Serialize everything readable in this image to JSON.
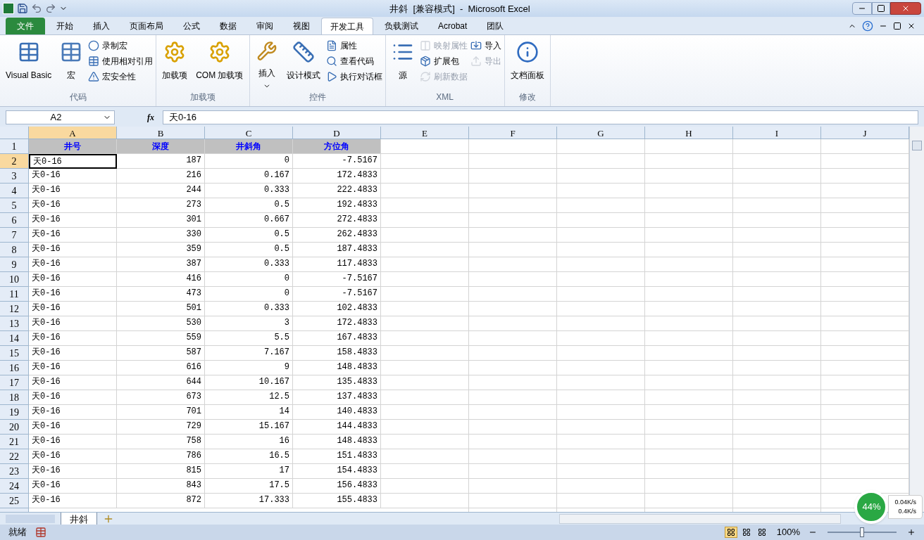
{
  "window": {
    "title": "井斜  [兼容模式]  -  Microsoft Excel"
  },
  "ribbon_tabs": [
    {
      "label": "文件",
      "kind": "file",
      "selected": false
    },
    {
      "label": "开始",
      "kind": "tab",
      "selected": false
    },
    {
      "label": "插入",
      "kind": "tab",
      "selected": false
    },
    {
      "label": "页面布局",
      "kind": "tab",
      "selected": false
    },
    {
      "label": "公式",
      "kind": "tab",
      "selected": false
    },
    {
      "label": "数据",
      "kind": "tab",
      "selected": false
    },
    {
      "label": "审阅",
      "kind": "tab",
      "selected": false
    },
    {
      "label": "视图",
      "kind": "tab",
      "selected": false
    },
    {
      "label": "开发工具",
      "kind": "tab",
      "selected": true
    },
    {
      "label": "负载测试",
      "kind": "tab",
      "selected": false
    },
    {
      "label": "Acrobat",
      "kind": "tab",
      "selected": false
    },
    {
      "label": "团队",
      "kind": "tab",
      "selected": false
    }
  ],
  "ribbon_groups": [
    {
      "label": "代码",
      "large": [
        {
          "label": "Visual Basic",
          "disabled": false
        },
        {
          "label": "宏",
          "disabled": false
        }
      ],
      "small": [
        {
          "label": "录制宏",
          "disabled": false
        },
        {
          "label": "使用相对引用",
          "disabled": false
        },
        {
          "label": "宏安全性",
          "disabled": false
        }
      ]
    },
    {
      "label": "加载项",
      "large": [
        {
          "label": "加载项",
          "disabled": false
        },
        {
          "label": "COM 加载项",
          "disabled": false
        }
      ]
    },
    {
      "label": "控件",
      "large": [
        {
          "label": "插入",
          "disabled": false,
          "dropdown": true
        },
        {
          "label": "设计模式",
          "disabled": false
        }
      ],
      "small": [
        {
          "label": "属性",
          "disabled": false
        },
        {
          "label": "查看代码",
          "disabled": false
        },
        {
          "label": "执行对话框",
          "disabled": false
        }
      ]
    },
    {
      "label": "XML",
      "large": [
        {
          "label": "源",
          "disabled": false
        }
      ],
      "small": [
        {
          "label": "映射属性",
          "disabled": true
        },
        {
          "label": "扩展包",
          "disabled": false
        },
        {
          "label": "刷新数据",
          "disabled": true
        },
        {
          "label": "导入",
          "disabled": false
        },
        {
          "label": "导出",
          "disabled": true
        }
      ]
    },
    {
      "label": "修改",
      "large": [
        {
          "label": "文档面板",
          "disabled": false
        }
      ]
    }
  ],
  "formula_bar": {
    "name_box": "A2",
    "fx": "fx",
    "value": "天0-16"
  },
  "columns": [
    {
      "label": "A",
      "selected": true
    },
    {
      "label": "B",
      "selected": false
    },
    {
      "label": "C",
      "selected": false
    },
    {
      "label": "D",
      "selected": false
    },
    {
      "label": "E",
      "selected": false
    },
    {
      "label": "F",
      "selected": false
    },
    {
      "label": "G",
      "selected": false
    },
    {
      "label": "H",
      "selected": false
    },
    {
      "label": "I",
      "selected": false
    },
    {
      "label": "J",
      "selected": false
    }
  ],
  "header_row": {
    "number": "1",
    "cells": [
      "井号",
      "深度",
      "井斜角",
      "方位角"
    ]
  },
  "rows": [
    {
      "number": "2",
      "selected": true,
      "cells": [
        "天0-16",
        "187",
        "0",
        "-7.5167"
      ]
    },
    {
      "number": "3",
      "selected": false,
      "cells": [
        "天0-16",
        "216",
        "0.167",
        "172.4833"
      ]
    },
    {
      "number": "4",
      "selected": false,
      "cells": [
        "天0-16",
        "244",
        "0.333",
        "222.4833"
      ]
    },
    {
      "number": "5",
      "selected": false,
      "cells": [
        "天0-16",
        "273",
        "0.5",
        "192.4833"
      ]
    },
    {
      "number": "6",
      "selected": false,
      "cells": [
        "天0-16",
        "301",
        "0.667",
        "272.4833"
      ]
    },
    {
      "number": "7",
      "selected": false,
      "cells": [
        "天0-16",
        "330",
        "0.5",
        "262.4833"
      ]
    },
    {
      "number": "8",
      "selected": false,
      "cells": [
        "天0-16",
        "359",
        "0.5",
        "187.4833"
      ]
    },
    {
      "number": "9",
      "selected": false,
      "cells": [
        "天0-16",
        "387",
        "0.333",
        "117.4833"
      ]
    },
    {
      "number": "10",
      "selected": false,
      "cells": [
        "天0-16",
        "416",
        "0",
        "-7.5167"
      ]
    },
    {
      "number": "11",
      "selected": false,
      "cells": [
        "天0-16",
        "473",
        "0",
        "-7.5167"
      ]
    },
    {
      "number": "12",
      "selected": false,
      "cells": [
        "天0-16",
        "501",
        "0.333",
        "102.4833"
      ]
    },
    {
      "number": "13",
      "selected": false,
      "cells": [
        "天0-16",
        "530",
        "3",
        "172.4833"
      ]
    },
    {
      "number": "14",
      "selected": false,
      "cells": [
        "天0-16",
        "559",
        "5.5",
        "167.4833"
      ]
    },
    {
      "number": "15",
      "selected": false,
      "cells": [
        "天0-16",
        "587",
        "7.167",
        "158.4833"
      ]
    },
    {
      "number": "16",
      "selected": false,
      "cells": [
        "天0-16",
        "616",
        "9",
        "148.4833"
      ]
    },
    {
      "number": "17",
      "selected": false,
      "cells": [
        "天0-16",
        "644",
        "10.167",
        "135.4833"
      ]
    },
    {
      "number": "18",
      "selected": false,
      "cells": [
        "天0-16",
        "673",
        "12.5",
        "137.4833"
      ]
    },
    {
      "number": "19",
      "selected": false,
      "cells": [
        "天0-16",
        "701",
        "14",
        "140.4833"
      ]
    },
    {
      "number": "20",
      "selected": false,
      "cells": [
        "天0-16",
        "729",
        "15.167",
        "144.4833"
      ]
    },
    {
      "number": "21",
      "selected": false,
      "cells": [
        "天0-16",
        "758",
        "16",
        "148.4833"
      ]
    },
    {
      "number": "22",
      "selected": false,
      "cells": [
        "天0-16",
        "786",
        "16.5",
        "151.4833"
      ]
    },
    {
      "number": "23",
      "selected": false,
      "cells": [
        "天0-16",
        "815",
        "17",
        "154.4833"
      ]
    },
    {
      "number": "24",
      "selected": false,
      "cells": [
        "天0-16",
        "843",
        "17.5",
        "156.4833"
      ]
    },
    {
      "number": "25",
      "selected": false,
      "cells": [
        "天0-16",
        "872",
        "17.333",
        "155.4833"
      ]
    }
  ],
  "sheet_tabs": [
    {
      "label": "井斜",
      "selected": true
    }
  ],
  "status_bar": {
    "status": "就绪",
    "views": [
      {
        "selected": true
      },
      {
        "selected": false
      },
      {
        "selected": false
      }
    ],
    "zoom": "100%",
    "zoom_slider": {
      "level": 0.5
    }
  },
  "network_widget": {
    "percent": "44%",
    "upload": "0.04K/s",
    "download": "0.4K/s"
  }
}
